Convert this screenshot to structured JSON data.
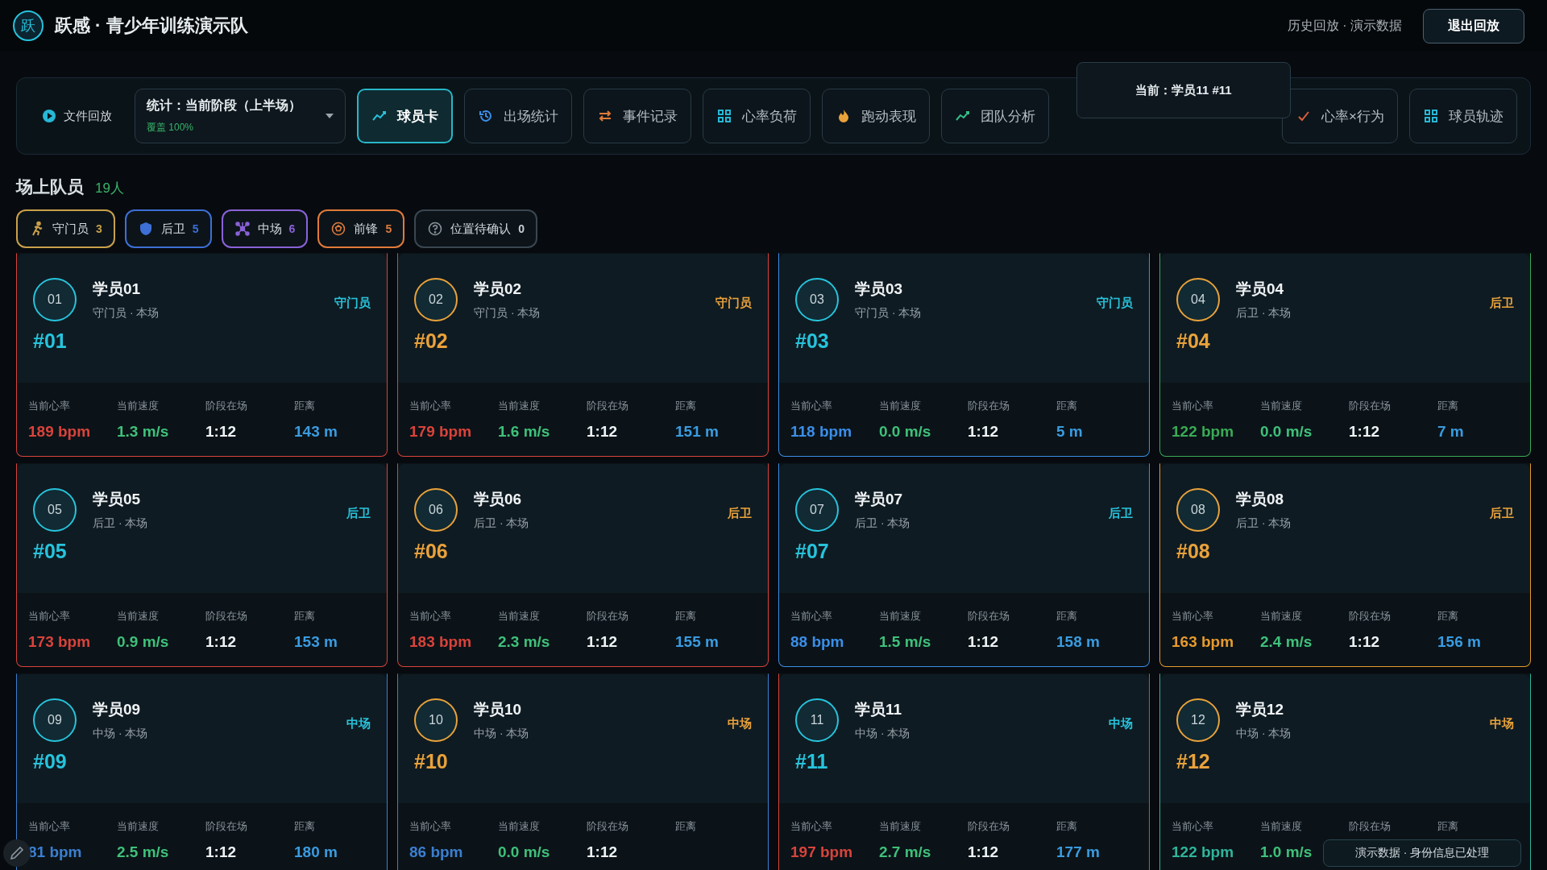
{
  "header": {
    "logo": "跃",
    "title": "跃感 · 青少年训练演示队",
    "mode": "历史回放 · 演示数据",
    "exit_button": "退出回放"
  },
  "toolbar": {
    "file_button": "文件回放",
    "select": {
      "value": "统计：当前阶段（上半场）",
      "coverage": "覆盖 100%"
    },
    "tabs": [
      {
        "label": "球员卡",
        "selected": true
      },
      {
        "label": "出场统计",
        "selected": false
      },
      {
        "label": "事件记录",
        "selected": false
      },
      {
        "label": "心率负荷",
        "selected": false
      },
      {
        "label": "跑动表现",
        "selected": false
      },
      {
        "label": "团队分析",
        "selected": false
      },
      {
        "label": "心率×行为",
        "selected": false
      },
      {
        "label": "球员轨迹",
        "selected": false
      }
    ]
  },
  "tooltip": "当前：学员11 #11",
  "section": {
    "title": "场上队员",
    "count": "19人"
  },
  "filters": [
    {
      "label": "守门员",
      "count": "3",
      "color": "#c9a04a"
    },
    {
      "label": "后卫",
      "count": "5",
      "color": "#3d6fd6"
    },
    {
      "label": "中场",
      "count": "6",
      "color": "#8a62d8"
    },
    {
      "label": "前锋",
      "count": "5",
      "color": "#e07a3a"
    },
    {
      "label": "位置待确认",
      "count": "0",
      "color": "#3a4650"
    }
  ],
  "players": [
    {
      "number": "01",
      "name": "学员01",
      "meta": "守门员 · 本场",
      "role": "守门员",
      "jersey": "#01",
      "kind": "cyan",
      "color": "#d9433b",
      "stats": [
        {
          "label": "当前心率",
          "value": "189 bpm"
        },
        {
          "label": "当前速度",
          "value": "1.3 m/s"
        },
        {
          "label": "阶段在场",
          "value": "1:12"
        },
        {
          "label": "距离",
          "value": "143 m"
        }
      ]
    },
    {
      "number": "02",
      "name": "学员02",
      "meta": "守门员 · 本场",
      "role": "守门员",
      "jersey": "#02",
      "kind": "amber",
      "color": "#d9433b",
      "stats": [
        {
          "label": "当前心率",
          "value": "179 bpm"
        },
        {
          "label": "当前速度",
          "value": "1.6 m/s"
        },
        {
          "label": "阶段在场",
          "value": "1:12"
        },
        {
          "label": "距离",
          "value": "151 m"
        }
      ]
    },
    {
      "number": "03",
      "name": "学员03",
      "meta": "守门员 · 本场",
      "role": "守门员",
      "jersey": "#03",
      "kind": "cyan",
      "color": "#3b8ee8",
      "stats": [
        {
          "label": "当前心率",
          "value": "118 bpm"
        },
        {
          "label": "当前速度",
          "value": "0.0 m/s"
        },
        {
          "label": "阶段在场",
          "value": "1:12"
        },
        {
          "label": "距离",
          "value": "5 m"
        }
      ]
    },
    {
      "number": "04",
      "name": "学员04",
      "meta": "后卫 · 本场",
      "role": "后卫",
      "jersey": "#04",
      "kind": "amber",
      "color": "#3aaa55",
      "stats": [
        {
          "label": "当前心率",
          "value": "122 bpm"
        },
        {
          "label": "当前速度",
          "value": "0.0 m/s"
        },
        {
          "label": "阶段在场",
          "value": "1:12"
        },
        {
          "label": "距离",
          "value": "7 m"
        }
      ]
    },
    {
      "number": "05",
      "name": "学员05",
      "meta": "后卫 · 本场",
      "role": "后卫",
      "jersey": "#05",
      "kind": "cyan",
      "color": "#d9433b",
      "stats": [
        {
          "label": "当前心率",
          "value": "173 bpm"
        },
        {
          "label": "当前速度",
          "value": "0.9 m/s"
        },
        {
          "label": "阶段在场",
          "value": "1:12"
        },
        {
          "label": "距离",
          "value": "153 m"
        }
      ]
    },
    {
      "number": "06",
      "name": "学员06",
      "meta": "后卫 · 本场",
      "role": "后卫",
      "jersey": "#06",
      "kind": "amber",
      "color": "#d9433b",
      "stats": [
        {
          "label": "当前心率",
          "value": "183 bpm"
        },
        {
          "label": "当前速度",
          "value": "2.3 m/s"
        },
        {
          "label": "阶段在场",
          "value": "1:12"
        },
        {
          "label": "距离",
          "value": "155 m"
        }
      ]
    },
    {
      "number": "07",
      "name": "学员07",
      "meta": "后卫 · 本场",
      "role": "后卫",
      "jersey": "#07",
      "kind": "cyan",
      "color": "#3b8ee8",
      "stats": [
        {
          "label": "当前心率",
          "value": "88 bpm"
        },
        {
          "label": "当前速度",
          "value": "1.5 m/s"
        },
        {
          "label": "阶段在场",
          "value": "1:12"
        },
        {
          "label": "距离",
          "value": "158 m"
        }
      ]
    },
    {
      "number": "08",
      "name": "学员08",
      "meta": "后卫 · 本场",
      "role": "后卫",
      "jersey": "#08",
      "kind": "amber",
      "color": "#e69a2e",
      "stats": [
        {
          "label": "当前心率",
          "value": "163 bpm"
        },
        {
          "label": "当前速度",
          "value": "2.4 m/s"
        },
        {
          "label": "阶段在场",
          "value": "1:12"
        },
        {
          "label": "距离",
          "value": "156 m"
        }
      ]
    },
    {
      "number": "09",
      "name": "学员09",
      "meta": "中场 · 本场",
      "role": "中场",
      "jersey": "#09",
      "kind": "cyan",
      "color": "#3b7fd0",
      "stats": [
        {
          "label": "当前心率",
          "value": "81 bpm"
        },
        {
          "label": "当前速度",
          "value": "2.5 m/s"
        },
        {
          "label": "阶段在场",
          "value": "1:12"
        },
        {
          "label": "距离",
          "value": "180 m"
        }
      ]
    },
    {
      "number": "10",
      "name": "学员10",
      "meta": "中场 · 本场",
      "role": "中场",
      "jersey": "#10",
      "kind": "amber",
      "color": "#3b7fd0",
      "stats": [
        {
          "label": "当前心率",
          "value": "86 bpm"
        },
        {
          "label": "当前速度",
          "value": "0.0 m/s"
        },
        {
          "label": "阶段在场",
          "value": "1:12"
        },
        {
          "label": "距离"
        }
      ]
    },
    {
      "number": "11",
      "name": "学员11",
      "meta": "中场 · 本场",
      "role": "中场",
      "jersey": "#11",
      "kind": "cyan",
      "color": "#d9433b",
      "stats": [
        {
          "label": "当前心率",
          "value": "197 bpm"
        },
        {
          "label": "当前速度",
          "value": "2.7 m/s"
        },
        {
          "label": "阶段在场",
          "value": "1:12"
        },
        {
          "label": "距离",
          "value": "177 m"
        }
      ]
    },
    {
      "number": "12",
      "name": "学员12",
      "meta": "中场 · 本场",
      "role": "中场",
      "jersey": "#12",
      "kind": "amber",
      "color": "#2fb59a",
      "stats": [
        {
          "label": "当前心率",
          "value": "122 bpm"
        },
        {
          "label": "当前速度",
          "value": "1.0 m/s"
        },
        {
          "label": "阶段在场"
        },
        {
          "label": "距离"
        }
      ]
    }
  ],
  "toast": "演示数据 · 身份信息已处理"
}
